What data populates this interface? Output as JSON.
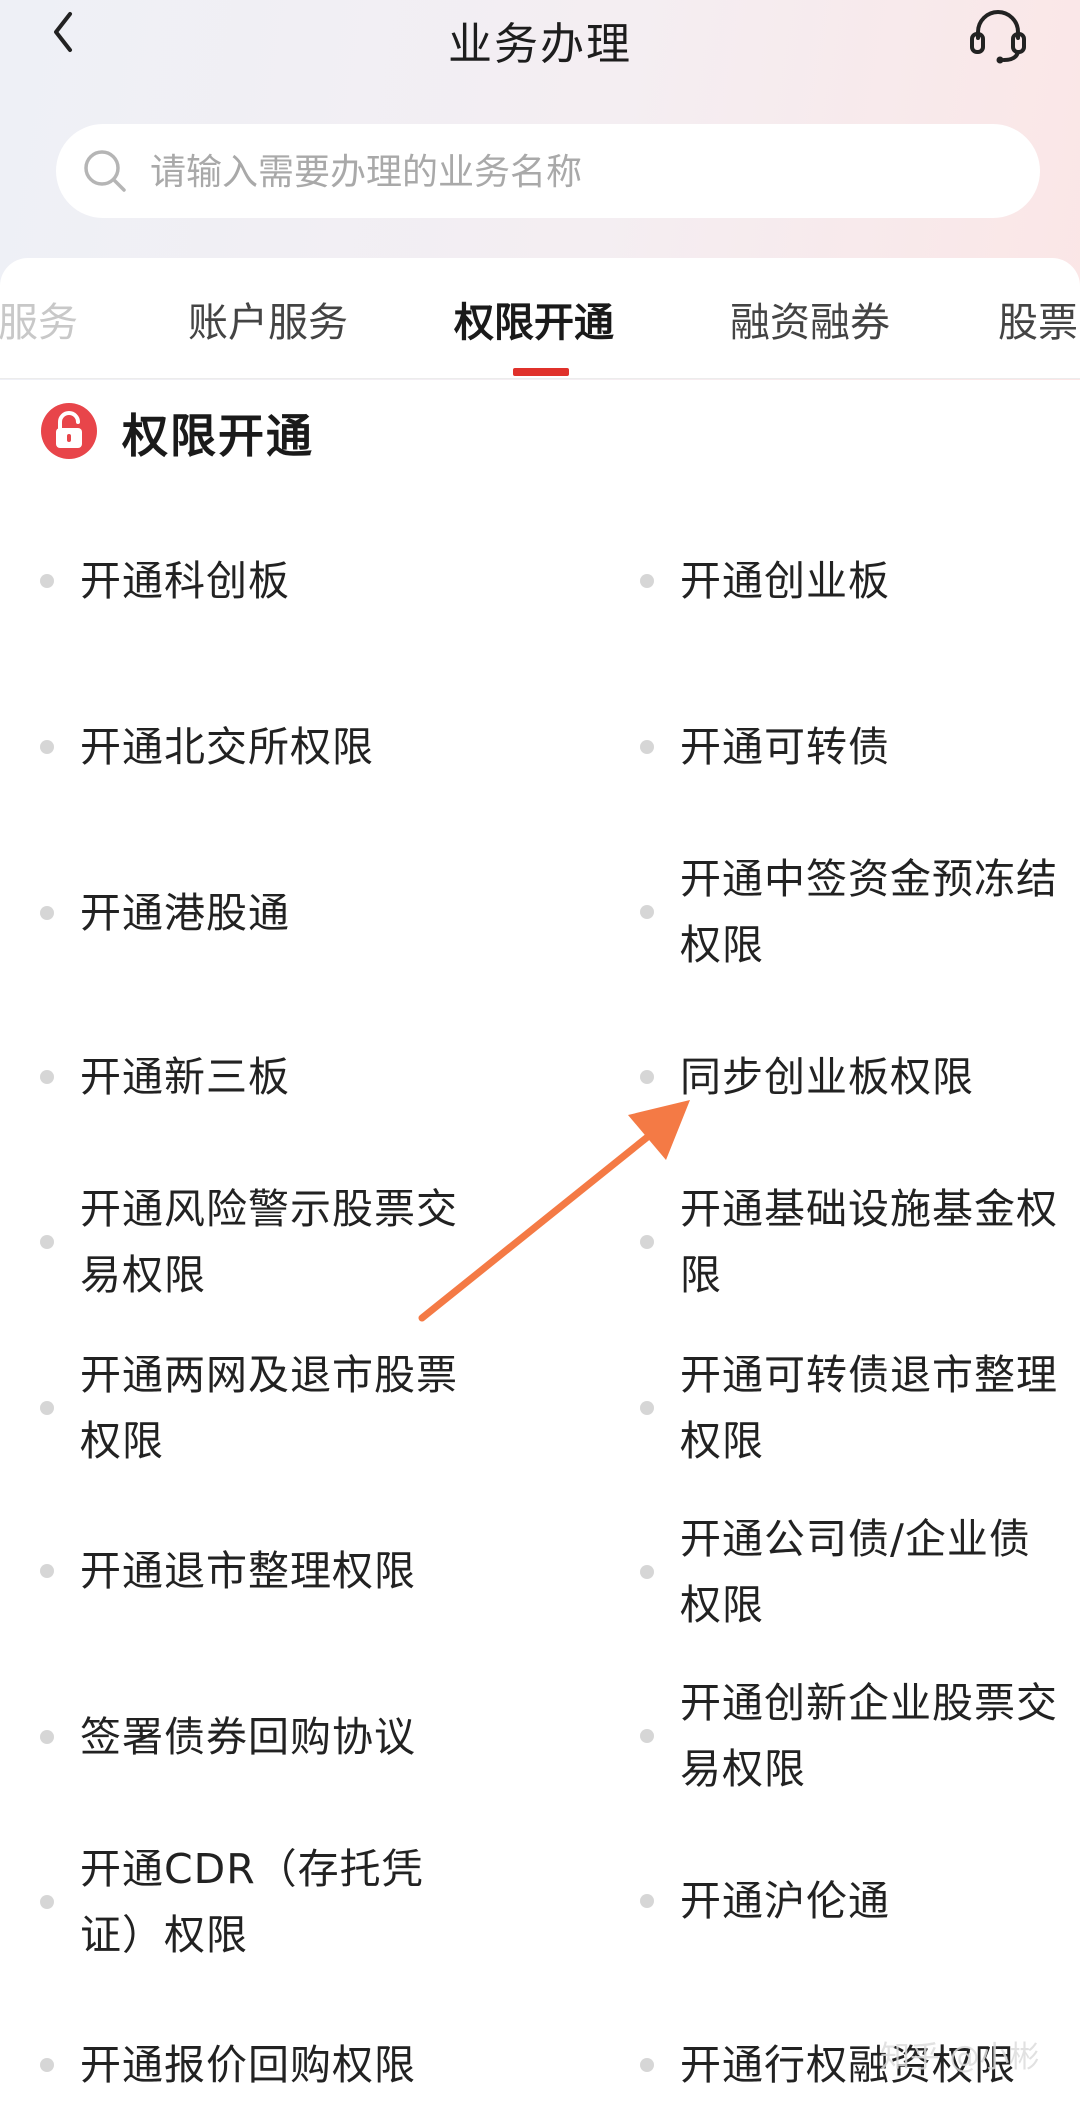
{
  "header": {
    "title": "业务办理",
    "back_icon": "chevron-left-icon",
    "support_icon": "headset-icon"
  },
  "search": {
    "placeholder": "请输入需要办理的业务名称",
    "value": ""
  },
  "tabs": [
    {
      "label": "服务",
      "state": "partial"
    },
    {
      "label": "账户服务",
      "state": "normal"
    },
    {
      "label": "权限开通",
      "state": "active"
    },
    {
      "label": "融资融券",
      "state": "normal"
    },
    {
      "label": "股票",
      "state": "partial"
    }
  ],
  "section": {
    "title": "权限开通",
    "icon": "unlock-icon"
  },
  "items": {
    "left": [
      {
        "label": "开通科创板"
      },
      {
        "label": "开通北交所权限"
      },
      {
        "label": "开通港股通"
      },
      {
        "label": "开通新三板"
      },
      {
        "label": "开通风险警示股票交易权限"
      },
      {
        "label": "开通两网及退市股票权限"
      },
      {
        "label": "开通退市整理权限"
      },
      {
        "label": "签署债券回购协议"
      },
      {
        "label": "开通CDR（存托凭证）权限"
      },
      {
        "label": "开通报价回购权限"
      }
    ],
    "right": [
      {
        "label": "开通创业板"
      },
      {
        "label": "开通可转债"
      },
      {
        "label": "开通中签资金预冻结权限"
      },
      {
        "label": "同步创业板权限"
      },
      {
        "label": "开通基础设施基金权限"
      },
      {
        "label": "开通可转债退市整理权限"
      },
      {
        "label": "开通公司债/企业债权限"
      },
      {
        "label": "开通创新企业股票交易权限"
      },
      {
        "label": "开通沪伦通"
      },
      {
        "label": "开通行权融资权限"
      }
    ]
  },
  "watermark": "知乎 @小彬",
  "colors": {
    "accent": "#e0312b",
    "arrow": "#f47a45",
    "dot": "#d6d6d6"
  }
}
